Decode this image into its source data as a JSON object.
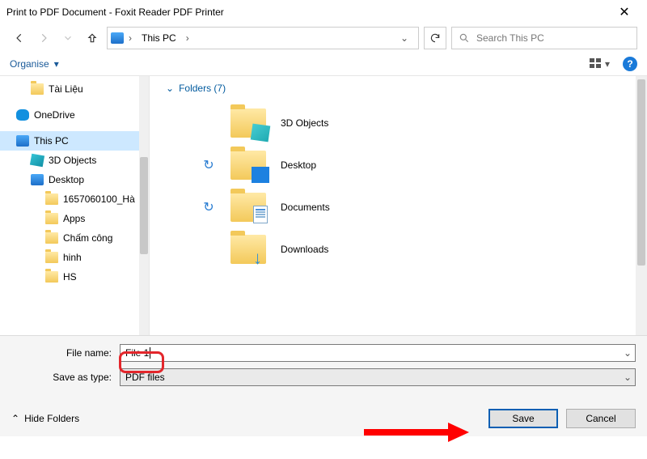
{
  "titlebar": {
    "title": "Print to PDF Document - Foxit Reader PDF Printer"
  },
  "address": {
    "root": "This PC",
    "sep": "›"
  },
  "search": {
    "placeholder": "Search This PC"
  },
  "toolbar": {
    "organise": "Organise"
  },
  "tree": {
    "items": [
      {
        "label": "Tài Liệu",
        "level": "l2",
        "ico": "folder-ico"
      },
      {
        "label": "OneDrive",
        "level": "l1",
        "ico": "onedrive-ico"
      },
      {
        "label": "This PC",
        "level": "l1",
        "ico": "pc-ico",
        "selected": true
      },
      {
        "label": "3D Objects",
        "level": "l2",
        "ico": "obj3d-ico"
      },
      {
        "label": "Desktop",
        "level": "l2",
        "ico": "pc-ico"
      },
      {
        "label": "1657060100_Hà",
        "level": "l3",
        "ico": "folder-ico"
      },
      {
        "label": "Apps",
        "level": "l3",
        "ico": "folder-ico"
      },
      {
        "label": "Chấm công",
        "level": "l3",
        "ico": "folder-ico"
      },
      {
        "label": "hinh",
        "level": "l3",
        "ico": "folder-ico"
      },
      {
        "label": "HS",
        "level": "l3",
        "ico": "folder-ico"
      }
    ]
  },
  "section": {
    "label": "Folders (7)"
  },
  "folders": [
    {
      "name": "3D Objects",
      "badge": "b-3d",
      "sync": ""
    },
    {
      "name": "Desktop",
      "badge": "b-desk",
      "sync": "↻"
    },
    {
      "name": "Documents",
      "badge": "b-doc",
      "sync": "↻"
    },
    {
      "name": "Downloads",
      "badge": "b-down",
      "sync": ""
    }
  ],
  "form": {
    "filename_label": "File name:",
    "filename_value": "File 1",
    "type_label": "Save as type:",
    "type_value": "PDF files"
  },
  "footer": {
    "hide": "Hide Folders",
    "save": "Save",
    "cancel": "Cancel"
  }
}
